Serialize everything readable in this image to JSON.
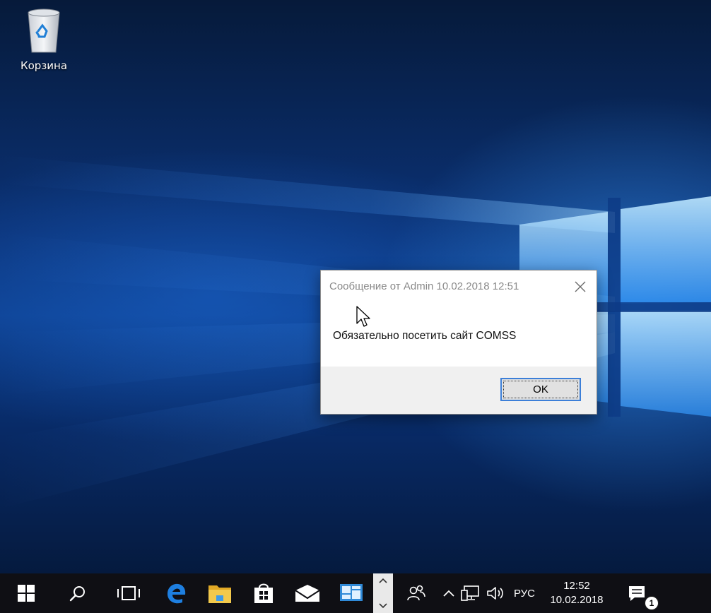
{
  "desktop": {
    "icons": [
      {
        "label": "Корзина",
        "icon": "recycle-bin-icon"
      }
    ]
  },
  "dialog": {
    "title": "Сообщение от Admin 10.02.2018 12:51",
    "message": "Обязательно посетить сайт COMSS",
    "ok_label": "OK",
    "close_icon": "close-icon"
  },
  "taskbar": {
    "pinned_apps": [
      {
        "name": "start",
        "icon": "windows-logo-icon"
      },
      {
        "name": "search",
        "icon": "search-icon"
      },
      {
        "name": "task-view",
        "icon": "task-view-icon"
      },
      {
        "name": "edge",
        "icon": "edge-icon"
      },
      {
        "name": "file-explorer",
        "icon": "folder-icon"
      },
      {
        "name": "store",
        "icon": "store-icon"
      },
      {
        "name": "mail",
        "icon": "mail-icon"
      },
      {
        "name": "remote-desktop",
        "icon": "remote-desktop-icon"
      }
    ],
    "language": "РУС",
    "time": "12:52",
    "date": "10.02.2018",
    "notification_count": "1"
  },
  "colors": {
    "taskbar_bg": "#0f0f14",
    "accent": "#3c7fd8",
    "edge_blue": "#1e7fe0",
    "folder_yellow": "#f2c94c"
  }
}
